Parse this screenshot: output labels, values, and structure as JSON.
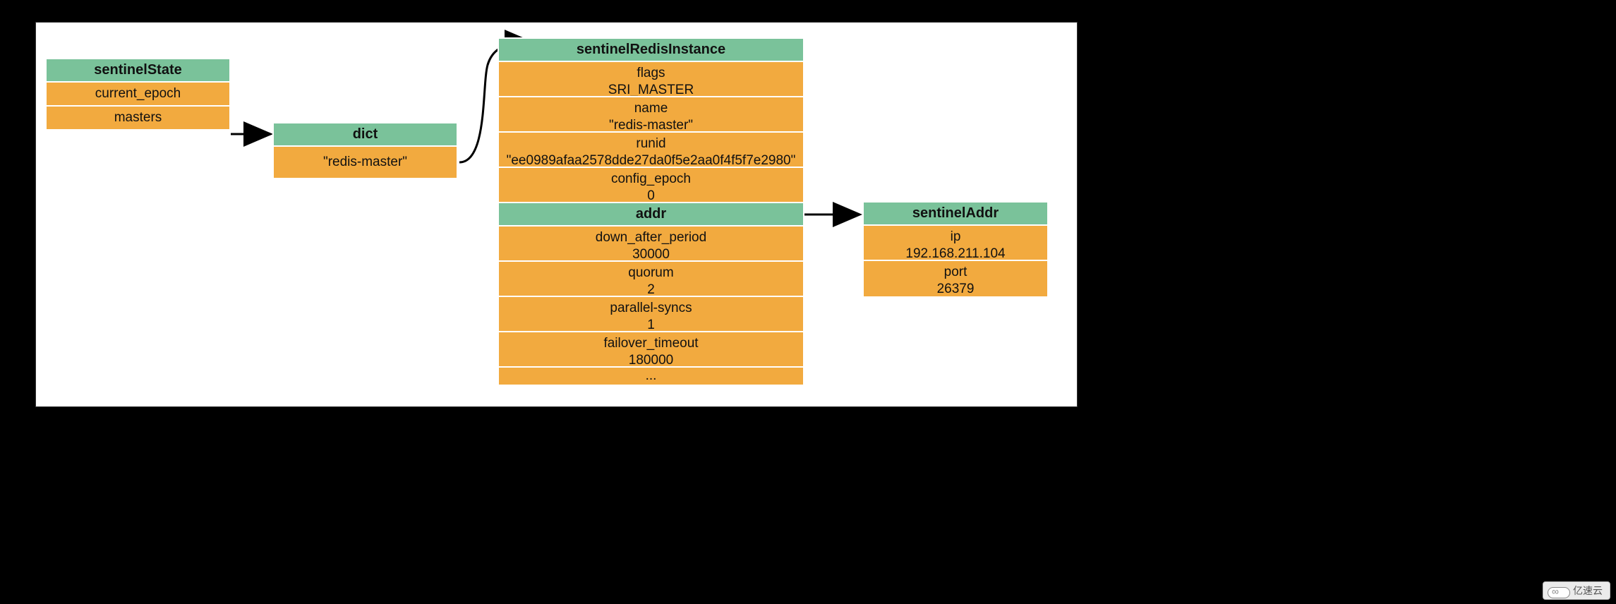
{
  "state": {
    "title": "sentinelState",
    "rows": [
      "current_epoch",
      "masters"
    ]
  },
  "dict": {
    "title": "dict",
    "rows": [
      "\"redis-master\""
    ]
  },
  "instance": {
    "title": "sentinelRedisInstance",
    "rows": [
      {
        "l1": "flags",
        "l2": "SRI_MASTER"
      },
      {
        "l1": "name",
        "l2": "\"redis-master\""
      },
      {
        "l1": "runid",
        "l2": "\"ee0989afaa2578dde27da0f5e2aa0f4f5f7e2980\""
      },
      {
        "l1": "config_epoch",
        "l2": "0"
      }
    ],
    "addr_title": "addr",
    "rows2": [
      {
        "l1": "down_after_period",
        "l2": "30000"
      },
      {
        "l1": "quorum",
        "l2": "2"
      },
      {
        "l1": "parallel-syncs",
        "l2": "1"
      },
      {
        "l1": "failover_timeout",
        "l2": "180000"
      },
      {
        "l1": "...",
        "l2": ""
      }
    ]
  },
  "addr": {
    "title": "sentinelAddr",
    "rows": [
      {
        "l1": "ip",
        "l2": "192.168.211.104"
      },
      {
        "l1": "port",
        "l2": "26379"
      }
    ]
  },
  "watermark": "亿速云"
}
